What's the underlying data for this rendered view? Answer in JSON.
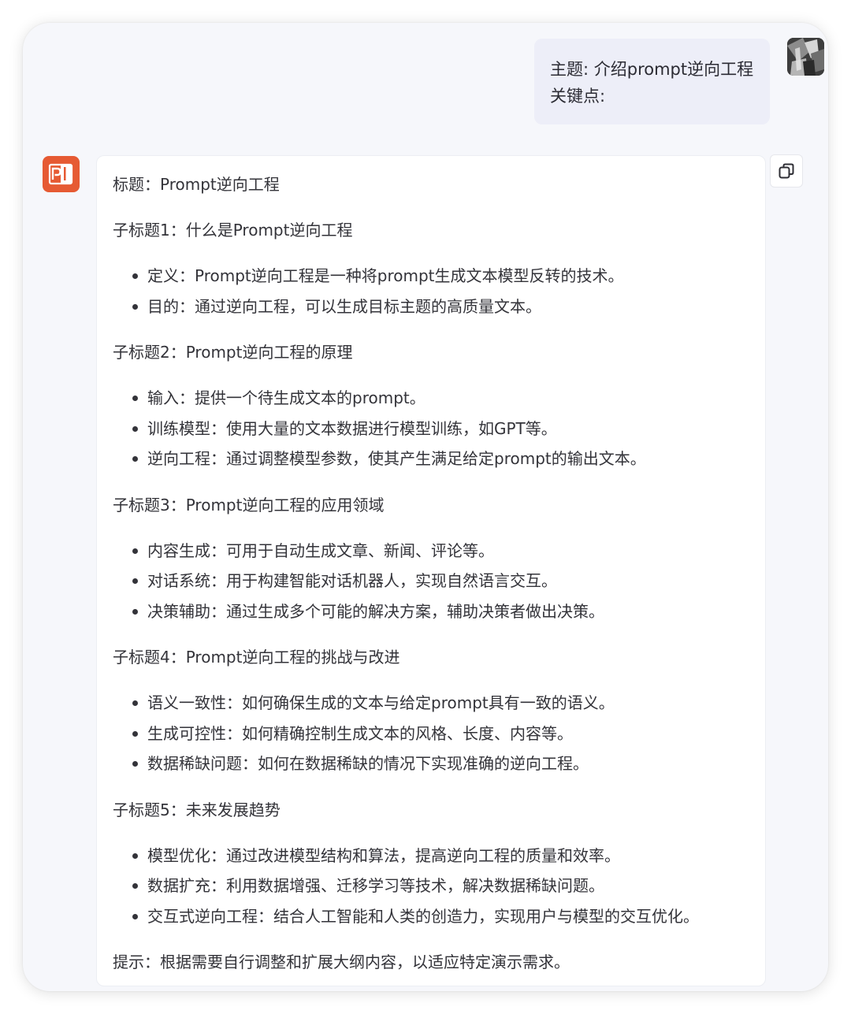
{
  "user_message": {
    "lines": [
      "主题: 介绍prompt逆向工程",
      "关键点:"
    ]
  },
  "assistant_message": {
    "title": "标题：Prompt逆向工程",
    "sections": [
      {
        "heading": "子标题1：什么是Prompt逆向工程",
        "items": [
          "定义：Prompt逆向工程是一种将prompt生成文本模型反转的技术。",
          "目的：通过逆向工程，可以生成目标主题的高质量文本。"
        ]
      },
      {
        "heading": "子标题2：Prompt逆向工程的原理",
        "items": [
          "输入：提供一个待生成文本的prompt。",
          "训练模型：使用大量的文本数据进行模型训练，如GPT等。",
          "逆向工程：通过调整模型参数，使其产生满足给定prompt的输出文本。"
        ]
      },
      {
        "heading": "子标题3：Prompt逆向工程的应用领域",
        "items": [
          "内容生成：可用于自动生成文章、新闻、评论等。",
          "对话系统：用于构建智能对话机器人，实现自然语言交互。",
          "决策辅助：通过生成多个可能的解决方案，辅助决策者做出决策。"
        ]
      },
      {
        "heading": "子标题4：Prompt逆向工程的挑战与改进",
        "items": [
          "语义一致性：如何确保生成的文本与给定prompt具有一致的语义。",
          "生成可控性：如何精确控制生成文本的风格、长度、内容等。",
          "数据稀缺问题：如何在数据稀缺的情况下实现准确的逆向工程。"
        ]
      },
      {
        "heading": "子标题5：未来发展趋势",
        "items": [
          "模型优化：通过改进模型结构和算法，提高逆向工程的质量和效率。",
          "数据扩充：利用数据增强、迁移学习等技术，解决数据稀缺问题。",
          "交互式逆向工程：结合人工智能和人类的创造力，实现用户与模型的交互优化。"
        ]
      }
    ],
    "tip": "提示：根据需要自行调整和扩展大纲内容，以适应特定演示需求。"
  },
  "icons": {
    "bot_avatar": "powerpoint-logo-icon",
    "user_avatar": "user-photo-avatar",
    "copy": "copy-icon"
  },
  "colors": {
    "bot_avatar_bg": "#e65a33",
    "user_bubble_bg": "#edeef8",
    "bot_bubble_bg": "#ffffff",
    "window_bg": "#f6f7fb"
  }
}
